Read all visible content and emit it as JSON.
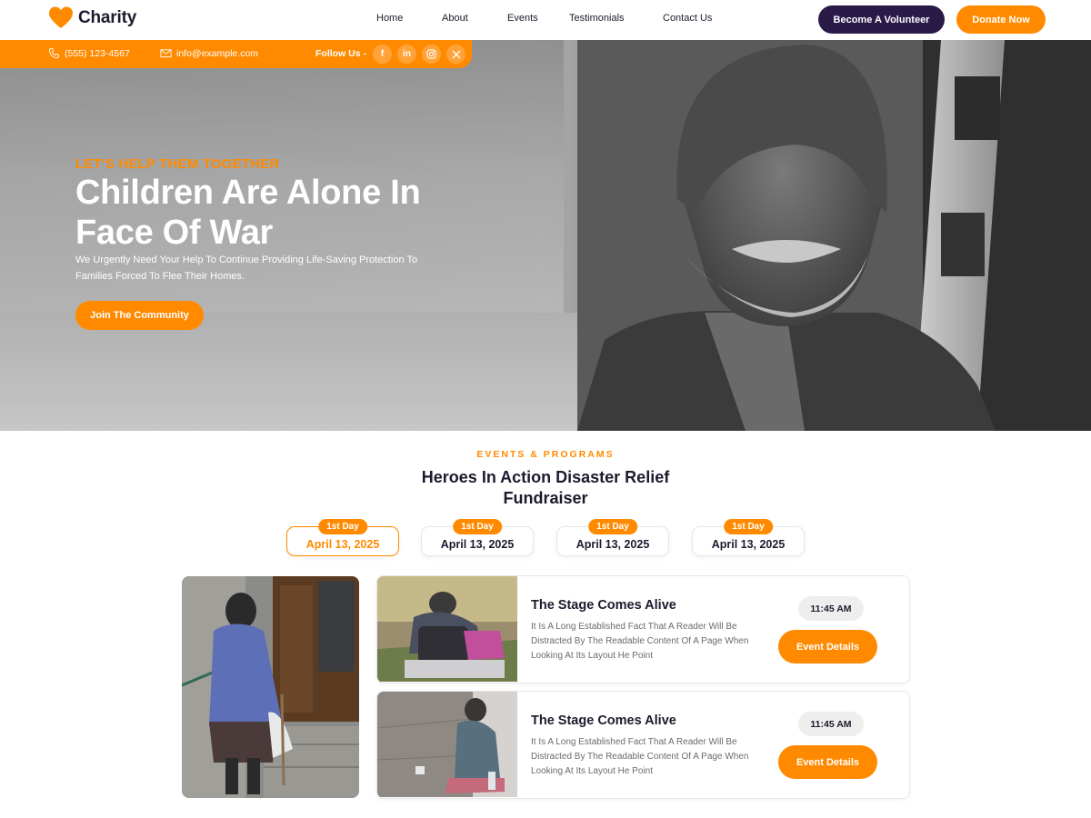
{
  "brand": {
    "name": "Charity",
    "accent": "#ff8a00",
    "dark": "#2a1a48"
  },
  "nav": {
    "items": [
      "Home",
      "About",
      "Events",
      "Testimonials",
      "Contact Us"
    ]
  },
  "header_actions": {
    "volunteer": "Become A Volunteer",
    "donate": "Donate Now"
  },
  "contact": {
    "phone": "(555) 123-4567",
    "email": "info@example.com",
    "follow_label": "Follow Us -",
    "socials": [
      "facebook-icon",
      "linkedin-icon",
      "instagram-icon",
      "x-icon"
    ]
  },
  "hero": {
    "kicker": "LET'S HELP THEM TOGETHER",
    "title": "Children Are Alone In Face Of War",
    "description": "We Urgently Need Your Help To Continue Providing Life-Saving Protection To Families Forced To Flee Their Homes.",
    "cta": "Join The Community"
  },
  "events": {
    "kicker": "EVENTS & PROGRAMS",
    "title": "Heroes In Action Disaster Relief Fundraiser",
    "days": [
      {
        "badge": "1st Day",
        "date": "April 13, 2025",
        "active": true
      },
      {
        "badge": "1st Day",
        "date": "April 13, 2025",
        "active": false
      },
      {
        "badge": "1st Day",
        "date": "April 13, 2025",
        "active": false
      },
      {
        "badge": "1st Day",
        "date": "April 13, 2025",
        "active": false
      }
    ],
    "cards": [
      {
        "title": "The Stage Comes Alive",
        "description": "It Is A Long Established Fact That A Reader Will Be Distracted By The Readable Content Of A Page When Looking At Its Layout He Point",
        "time": "11:45 AM",
        "cta": "Event Details"
      },
      {
        "title": "The Stage Comes Alive",
        "description": "It Is A Long Established Fact That A Reader Will Be Distracted By The Readable Content Of A Page When Looking At Its Layout He Point",
        "time": "11:45 AM",
        "cta": "Event Details"
      }
    ]
  }
}
